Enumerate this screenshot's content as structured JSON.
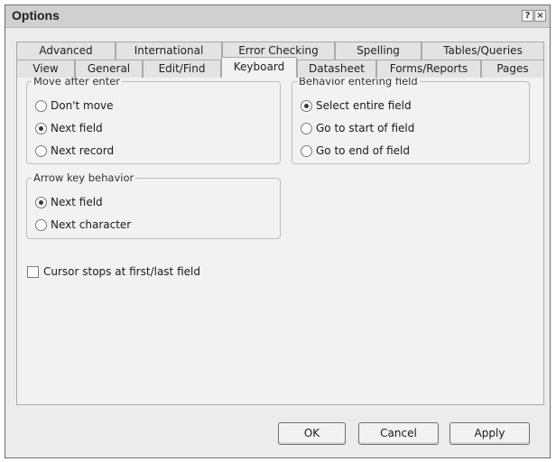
{
  "window": {
    "title": "Options"
  },
  "title_buttons": {
    "help": "?",
    "close": "×"
  },
  "tabs_back": [
    "Advanced",
    "International",
    "Error Checking",
    "Spelling",
    "Tables/Queries"
  ],
  "tabs_front": [
    "View",
    "General",
    "Edit/Find",
    "Keyboard",
    "Datasheet",
    "Forms/Reports",
    "Pages"
  ],
  "active_tab": "Keyboard",
  "groups": {
    "move_after_enter": {
      "legend": "Move after enter",
      "options": [
        "Don't move",
        "Next field",
        "Next record"
      ],
      "selected": "Next field"
    },
    "arrow_key_behavior": {
      "legend": "Arrow key behavior",
      "options": [
        "Next field",
        "Next character"
      ],
      "selected": "Next field"
    },
    "behavior_entering_field": {
      "legend": "Behavior entering field",
      "options": [
        "Select entire field",
        "Go to start of field",
        "Go to end of field"
      ],
      "selected": "Select entire field"
    }
  },
  "cursor_stops": {
    "label": "Cursor stops at first/last field",
    "checked": false
  },
  "buttons": {
    "ok": "OK",
    "cancel": "Cancel",
    "apply": "Apply"
  }
}
